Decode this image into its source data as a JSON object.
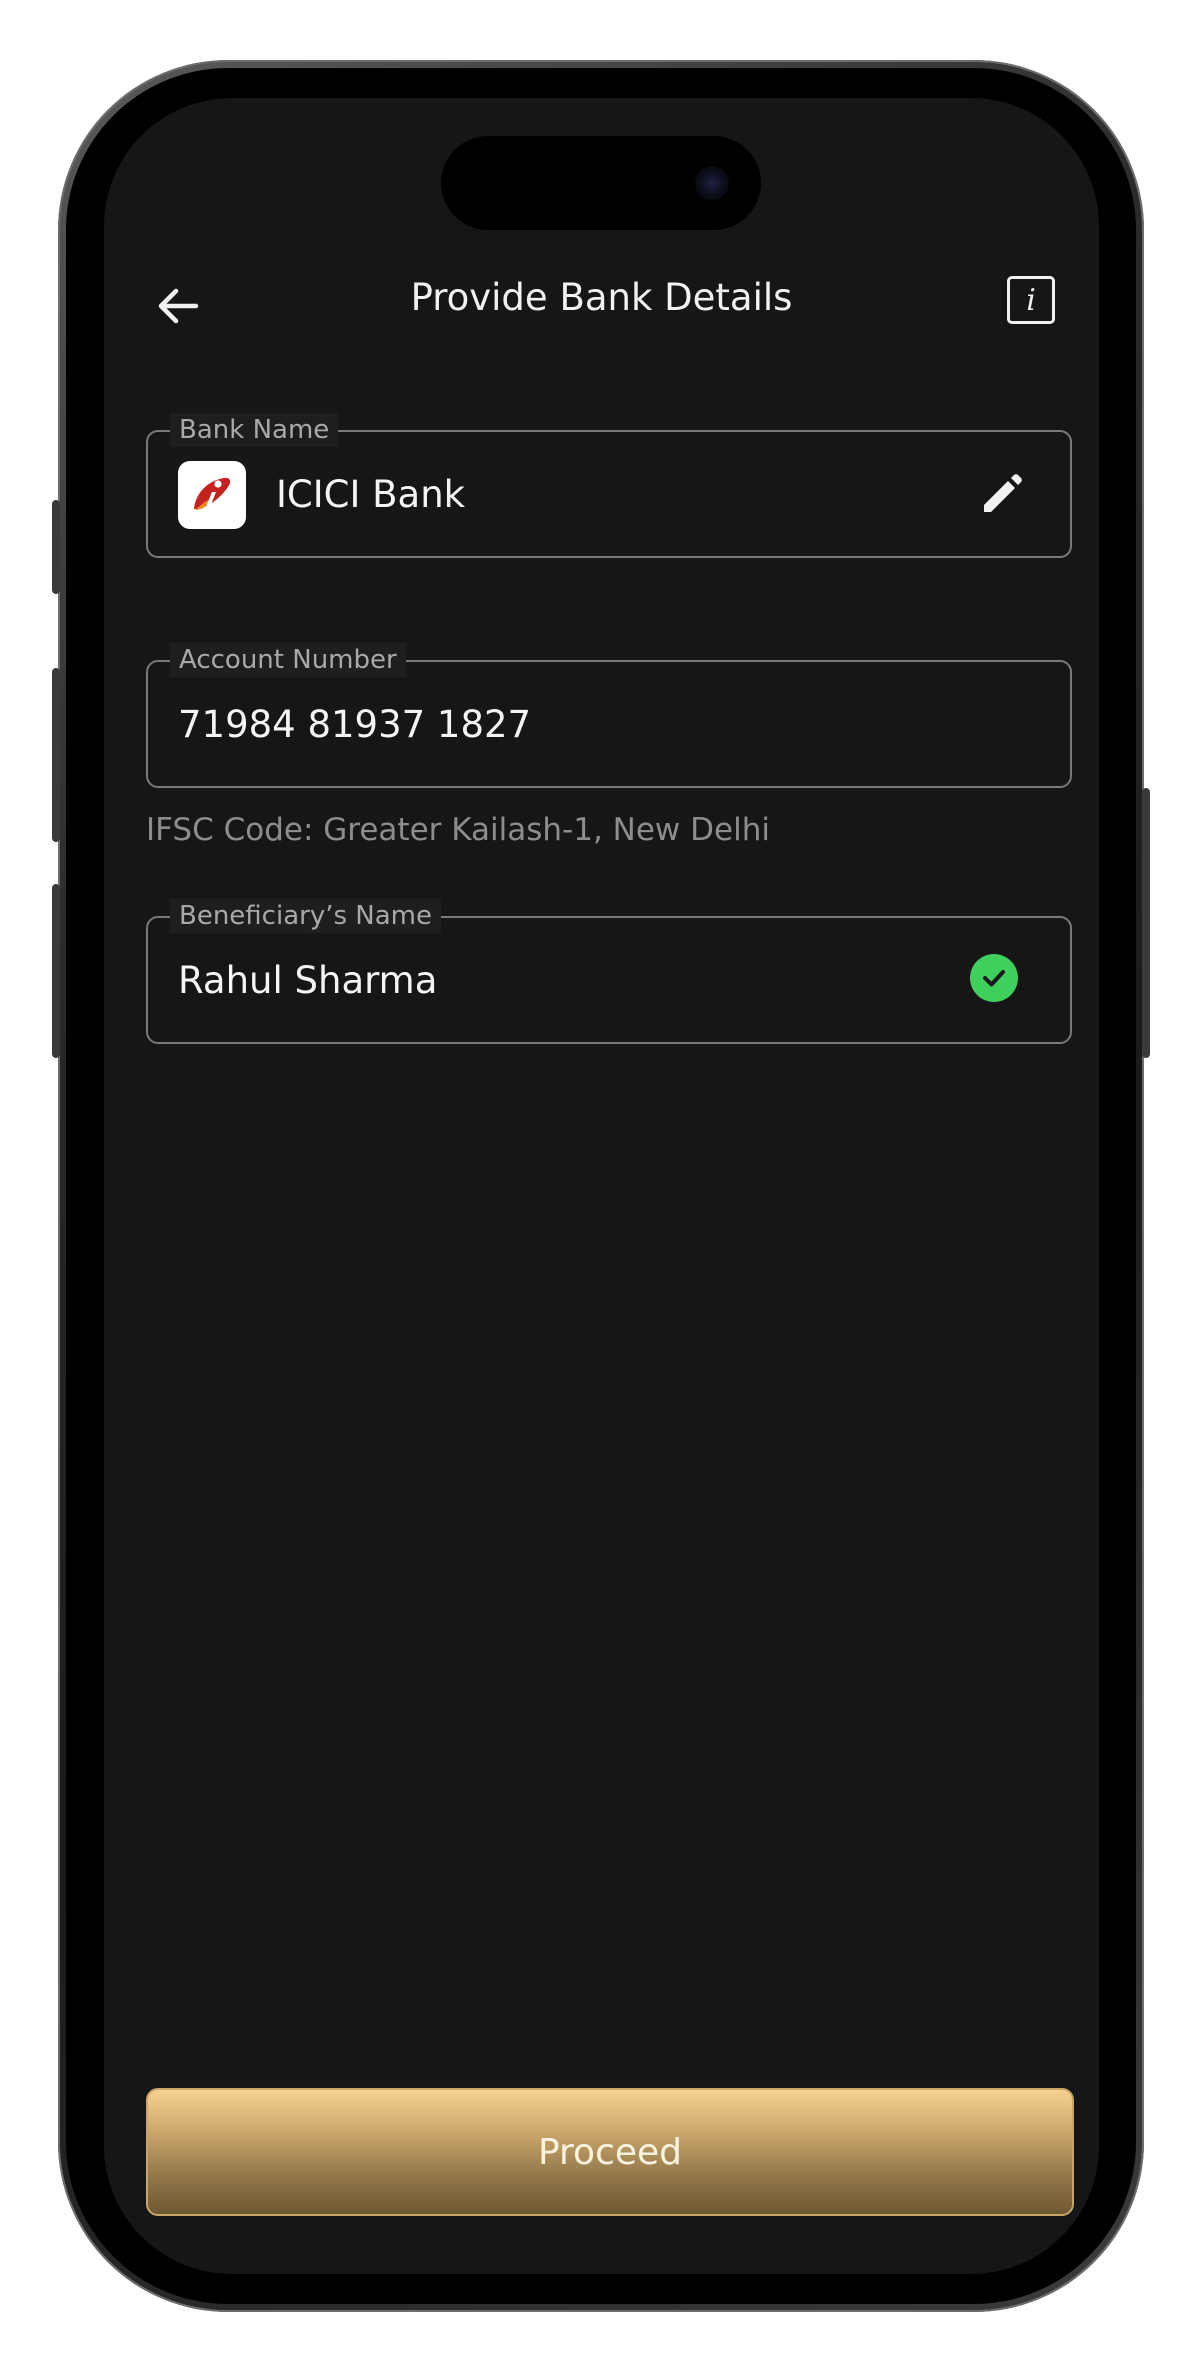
{
  "header": {
    "title": "Provide Bank Details",
    "back_icon": "arrow-left-icon",
    "info_icon": "info-icon",
    "info_glyph": "i"
  },
  "form": {
    "bank": {
      "label": "Bank Name",
      "value": "ICICI Bank",
      "logo_icon": "icici-bank-logo",
      "action_icon": "pencil-icon"
    },
    "account": {
      "label": "Account Number",
      "value": "71984 81937 1827"
    },
    "ifsc_text": "IFSC Code: Greater Kailash-1, New Delhi",
    "beneficiary": {
      "label": "Beneficiary’s Name",
      "value": "Rahul Sharma",
      "status_icon": "check-circle-icon",
      "status_color": "#3fcf5c"
    }
  },
  "footer": {
    "proceed_label": "Proceed"
  },
  "colors": {
    "background": "#161616",
    "border": "#7a7a7a",
    "accent_gold": "#c4a168"
  }
}
